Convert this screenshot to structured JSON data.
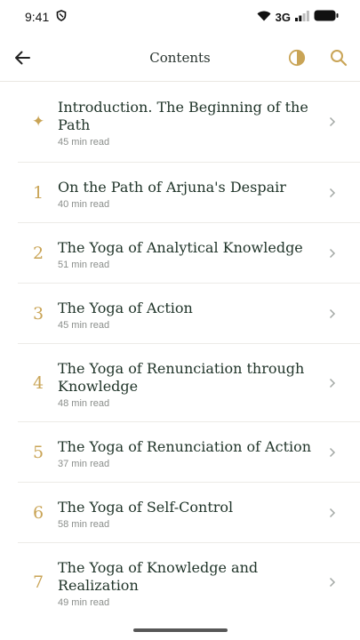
{
  "status": {
    "time": "9:41",
    "network": "3G",
    "icons": [
      "shield-icon",
      "wifi-icon",
      "signal-icon",
      "battery-icon"
    ]
  },
  "header": {
    "title": "Contents",
    "icons": [
      "arrow-left-icon",
      "contrast-icon",
      "search-icon"
    ]
  },
  "colors": {
    "accent": "#c9a456",
    "title_text": "#1f3328",
    "meta_text": "#8a8e8b",
    "divider": "#ecebe7",
    "chevron": "#a3a8a5"
  },
  "chapters": [
    {
      "marker": "✦",
      "title": "Introduction. The Beginning of the Path",
      "meta": "45 min read"
    },
    {
      "marker": "1",
      "title": "On the Path of Arjuna's Despair",
      "meta": "40 min read"
    },
    {
      "marker": "2",
      "title": "The Yoga of Analytical Knowledge",
      "meta": "51 min read"
    },
    {
      "marker": "3",
      "title": "The Yoga of Action",
      "meta": "45 min read"
    },
    {
      "marker": "4",
      "title": "The Yoga of Renunciation through Knowledge",
      "meta": "48 min read"
    },
    {
      "marker": "5",
      "title": "The Yoga of Renunciation of Action",
      "meta": "37 min read"
    },
    {
      "marker": "6",
      "title": "The Yoga of Self-Control",
      "meta": "58 min read"
    },
    {
      "marker": "7",
      "title": "The Yoga of Knowledge and Realization",
      "meta": "49 min read"
    }
  ]
}
